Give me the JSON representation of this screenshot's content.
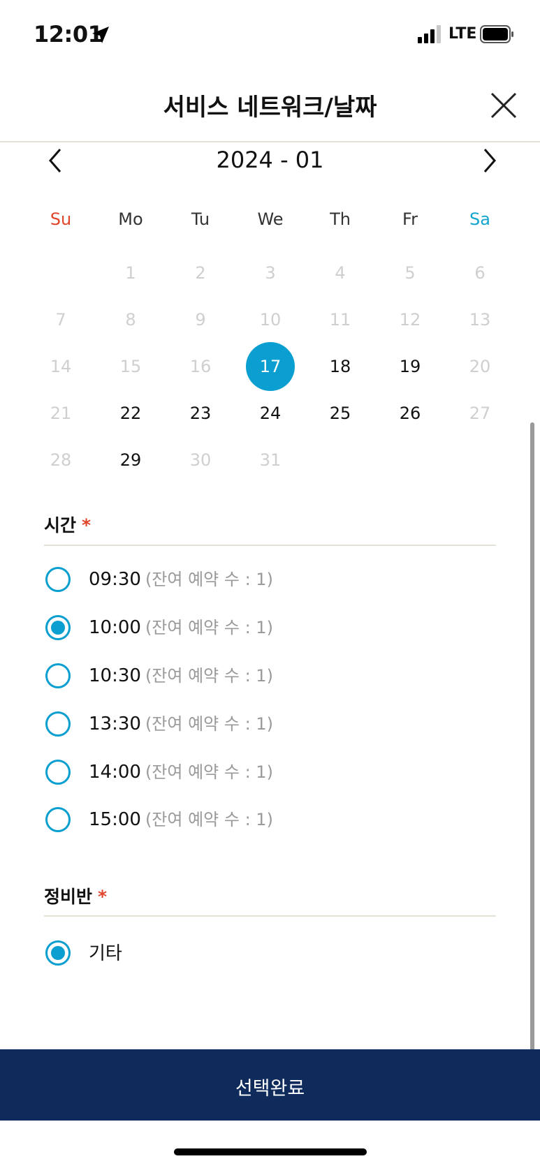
{
  "status_bar": {
    "time": "12:01",
    "network": "LTE"
  },
  "header": {
    "title": "서비스 네트워크/날짜"
  },
  "calendar": {
    "month_label": "2024 - 01",
    "weekdays": [
      "Su",
      "Mo",
      "Tu",
      "We",
      "Th",
      "Fr",
      "Sa"
    ],
    "days": [
      {
        "d": "1",
        "state": "disabled"
      },
      {
        "d": "2",
        "state": "disabled"
      },
      {
        "d": "3",
        "state": "disabled"
      },
      {
        "d": "4",
        "state": "disabled"
      },
      {
        "d": "5",
        "state": "disabled"
      },
      {
        "d": "6",
        "state": "disabled"
      },
      {
        "d": "7",
        "state": "disabled"
      },
      {
        "d": "8",
        "state": "disabled"
      },
      {
        "d": "9",
        "state": "disabled"
      },
      {
        "d": "10",
        "state": "disabled"
      },
      {
        "d": "11",
        "state": "disabled"
      },
      {
        "d": "12",
        "state": "disabled"
      },
      {
        "d": "13",
        "state": "disabled"
      },
      {
        "d": "14",
        "state": "disabled"
      },
      {
        "d": "15",
        "state": "disabled"
      },
      {
        "d": "16",
        "state": "disabled"
      },
      {
        "d": "17",
        "state": "selected"
      },
      {
        "d": "18",
        "state": "active"
      },
      {
        "d": "19",
        "state": "active"
      },
      {
        "d": "20",
        "state": "disabled"
      },
      {
        "d": "21",
        "state": "disabled"
      },
      {
        "d": "22",
        "state": "active"
      },
      {
        "d": "23",
        "state": "active"
      },
      {
        "d": "24",
        "state": "active"
      },
      {
        "d": "25",
        "state": "active"
      },
      {
        "d": "26",
        "state": "active"
      },
      {
        "d": "27",
        "state": "disabled"
      },
      {
        "d": "28",
        "state": "disabled"
      },
      {
        "d": "29",
        "state": "active"
      },
      {
        "d": "30",
        "state": "disabled"
      },
      {
        "d": "31",
        "state": "disabled"
      }
    ]
  },
  "time_section": {
    "title": "시간",
    "required_mark": "*",
    "options": [
      {
        "time": "09:30",
        "remaining": "(잔여 예약 수 : 1)",
        "checked": false
      },
      {
        "time": "10:00",
        "remaining": "(잔여 예약 수 : 1)",
        "checked": true
      },
      {
        "time": "10:30",
        "remaining": "(잔여 예약 수 : 1)",
        "checked": false
      },
      {
        "time": "13:30",
        "remaining": "(잔여 예약 수 : 1)",
        "checked": false
      },
      {
        "time": "14:00",
        "remaining": "(잔여 예약 수 : 1)",
        "checked": false
      },
      {
        "time": "15:00",
        "remaining": "(잔여 예약 수 : 1)",
        "checked": false
      }
    ]
  },
  "team_section": {
    "title": "정비반",
    "required_mark": "*",
    "options": [
      {
        "label": "기타",
        "checked": true
      }
    ]
  },
  "footer": {
    "confirm_label": "선택완료"
  },
  "colors": {
    "accent": "#0a9fd0",
    "sunday": "#e0452b",
    "saturday": "#12a5cf",
    "footer_bg": "#0e2b5c"
  }
}
